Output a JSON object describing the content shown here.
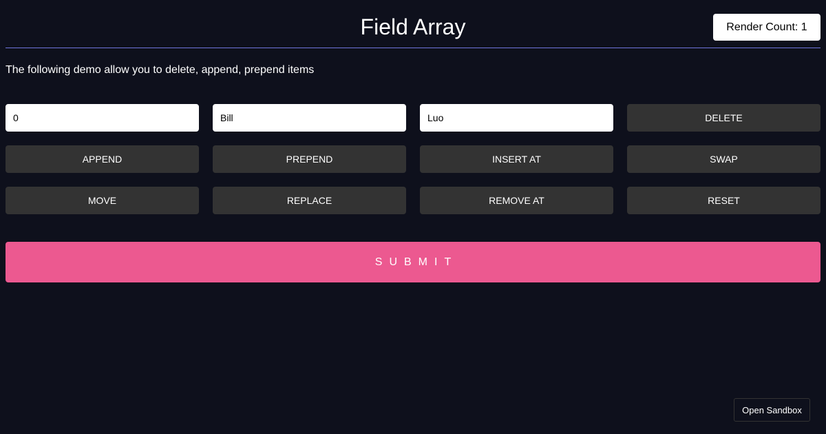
{
  "header": {
    "title": "Field Array",
    "render_count": "Render Count: 1"
  },
  "description": "The following demo allow you to delete, append, prepend items",
  "fields": {
    "index_value": "0",
    "first_name_value": "Bill",
    "last_name_value": "Luo"
  },
  "actions": {
    "delete": "DELETE",
    "append": "APPEND",
    "prepend": "PREPEND",
    "insert_at": "INSERT AT",
    "swap": "SWAP",
    "move": "MOVE",
    "replace": "REPLACE",
    "remove_at": "REMOVE AT",
    "reset": "RESET"
  },
  "submit_label": "SUBMIT",
  "sandbox_label": "Open Sandbox",
  "colors": {
    "background": "#0e101c",
    "accent": "#ec5990",
    "divider": "#6f74dd",
    "button": "#333333"
  }
}
